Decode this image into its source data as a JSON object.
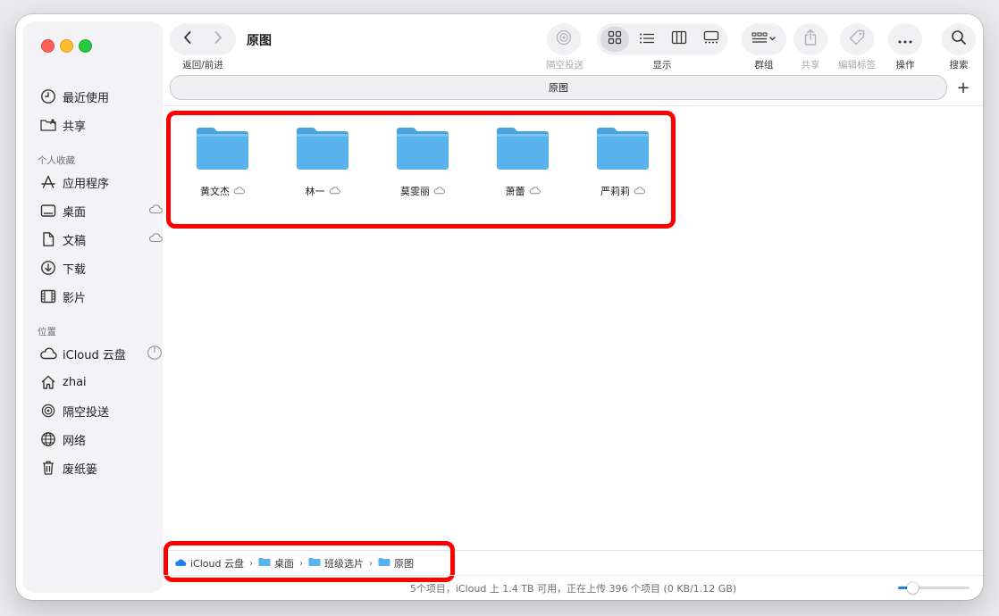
{
  "window": {
    "title": "原图"
  },
  "sidebar": {
    "top_items": [
      {
        "label": "最近使用",
        "icon": "clock-icon"
      },
      {
        "label": "共享",
        "icon": "shared-folder-icon"
      }
    ],
    "favorites_header": "个人收藏",
    "favorites": [
      {
        "label": "应用程序",
        "icon": "applications-icon",
        "cloud": false
      },
      {
        "label": "桌面",
        "icon": "desktop-icon",
        "cloud": true
      },
      {
        "label": "文稿",
        "icon": "document-icon",
        "cloud": true
      },
      {
        "label": "下载",
        "icon": "download-icon",
        "cloud": false
      },
      {
        "label": "影片",
        "icon": "film-icon",
        "cloud": false
      }
    ],
    "locations_header": "位置",
    "locations": [
      {
        "label": "iCloud 云盘",
        "icon": "icloud-icon"
      },
      {
        "label": "zhai",
        "icon": "home-icon"
      },
      {
        "label": "隔空投送",
        "icon": "airdrop-icon"
      },
      {
        "label": "网络",
        "icon": "network-icon"
      },
      {
        "label": "废纸篓",
        "icon": "trash-icon"
      }
    ]
  },
  "toolbar": {
    "nav_label": "返回/前进",
    "airdrop_label": "隔空投送",
    "view_label": "显示",
    "group_label": "群组",
    "share_label": "共享",
    "tags_label": "编辑标签",
    "action_label": "操作",
    "search_label": "搜索"
  },
  "tab": {
    "label": "原图"
  },
  "folders": [
    {
      "name": "黄文杰"
    },
    {
      "name": "林一"
    },
    {
      "name": "莫雯丽"
    },
    {
      "name": "萧蕾"
    },
    {
      "name": "严莉莉"
    }
  ],
  "pathbar": [
    "iCloud 云盘",
    "桌面",
    "班级选片",
    "原图"
  ],
  "status": {
    "text": "5个项目，iCloud 上 1.4 TB 可用，正在上传 396 个项目 (0 KB/1.12 GB)",
    "icon_size_fraction": 0.2
  },
  "colors": {
    "accent": "#1f7ff0",
    "highlight": "#ff0000",
    "folder": "#5ab2ec"
  }
}
